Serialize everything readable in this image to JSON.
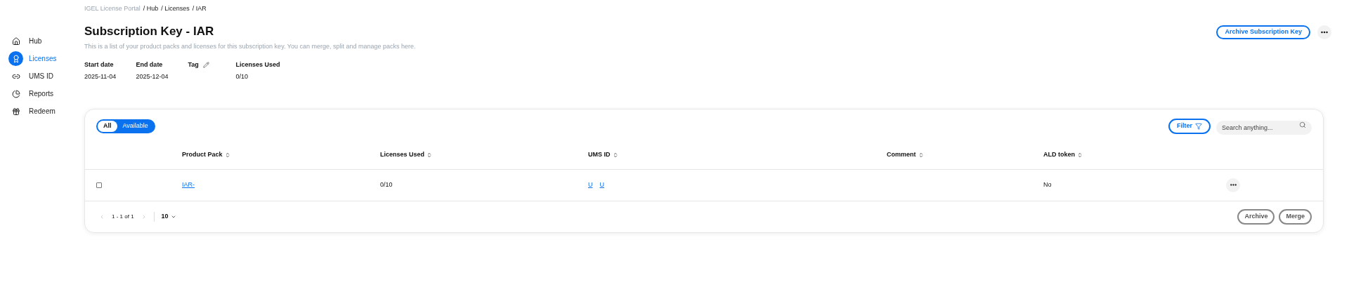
{
  "breadcrumb": [
    {
      "label": "IGEL License Portal",
      "current": false
    },
    {
      "label": "/ Hub",
      "current": true
    },
    {
      "label": "/ Licenses",
      "current": true
    },
    {
      "label": "/ IAR",
      "current": true
    }
  ],
  "sidebar": {
    "items": [
      {
        "label": "Hub",
        "selected": false
      },
      {
        "label": "Licenses",
        "selected": true
      },
      {
        "label": "UMS ID",
        "selected": false
      },
      {
        "label": "Reports",
        "selected": false
      },
      {
        "label": "Redeem",
        "selected": false
      }
    ]
  },
  "title": "Subscription Key - IAR",
  "description": "This is a list of your product packs and licenses for this subscription key. You can merge, split and manage packs here.",
  "header_button": "Archive Subscription Key",
  "details": [
    {
      "label": "Start date",
      "value": "2025-11-04",
      "editable": false
    },
    {
      "label": "End date",
      "value": "2025-12-04",
      "editable": false
    },
    {
      "label": "Tag",
      "editable": true
    },
    {
      "label": "Licenses Used",
      "value": "0/10",
      "editable": false
    }
  ],
  "toggle": [
    {
      "label": "All",
      "selected": true
    },
    {
      "label": "Available",
      "selected": false
    }
  ],
  "filter_button": "Filter",
  "search": {
    "placeholder": "Search anything..."
  },
  "table": {
    "columns": [
      "Product Pack",
      "Licenses Used",
      "UMS ID",
      "Comment",
      "ALD token"
    ],
    "rows": [
      {
        "checked": false,
        "product_pack": "IAR-",
        "licenses_used": "0/10",
        "ums_ids": [
          "U",
          "U"
        ],
        "ald_token": "No"
      }
    ]
  },
  "pagination": {
    "range": "1 - 1 of 1",
    "page_size": "10"
  },
  "footer_buttons": [
    "Archive",
    "Merge"
  ]
}
